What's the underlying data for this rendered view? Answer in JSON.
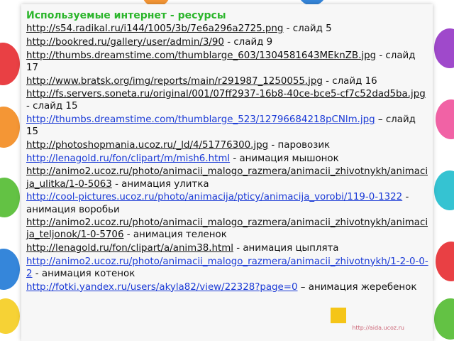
{
  "heading": "Используемые интернет - ресурсы",
  "entries": [
    {
      "url": "http://s54.radikal.ru/i144/1005/3b/7e6a296a2725.png",
      "desc": " - слайд 5",
      "color": "dark"
    },
    {
      "url": "http://bookred.ru/gallery/user/admin/3/90",
      "desc": " - слайд 9",
      "color": "dark"
    },
    {
      "url": "http://thumbs.dreamstime.com/thumblarge_603/1304581643MEknZB.jpg",
      "desc": " - слайд 17",
      "color": "dark"
    },
    {
      "url": "http://www.bratsk.org/img/reports/main/r291987_1250055.jpg",
      "desc": " - слайд 16",
      "color": "dark"
    },
    {
      "url": "http://fs.servers.soneta.ru/original/001/07ff2937-16b8-40ce-bce5-cf7c52dad5ba.jpg",
      "desc": " - слайд 15",
      "color": "dark"
    },
    {
      "url": "http://thumbs.dreamstime.com/thumblarge_523/12796684218pCNlm.jpg",
      "desc": " – слайд 15",
      "color": "blue"
    },
    {
      "url": "http://photoshopmania.ucoz.ru/_ld/4/51776300.jpg",
      "desc": " - паровозик",
      "color": "dark"
    },
    {
      "url": "http://lenagold.ru/fon/clipart/m/mish6.html",
      "desc": " - анимация мышонок",
      "color": "blue"
    },
    {
      "url": "http://animo2.ucoz.ru/photo/animacii_malogo_razmera/animacii_zhivotnykh/animacija_ulitka/1-0-5063",
      "desc": " - анимация улитка",
      "color": "dark"
    },
    {
      "url": "http://cool-pictures.ucoz.ru/photo/animacija/pticy/animacija_vorobi/119-0-1322",
      "desc": " - анимация воробьи",
      "color": "blue"
    },
    {
      "url": "http://animo2.ucoz.ru/photo/animacii_malogo_razmera/animacii_zhivotnykh/animacija_teljonok/1-0-5706",
      "desc": " - анимация теленок",
      "color": "dark"
    },
    {
      "url": "http://lenagold.ru/fon/clipart/a/anim38.html",
      "desc": " - анимация цыплята",
      "color": "dark"
    },
    {
      "url": "http://animo2.ucoz.ru/photo/animacii_malogo_razmera/animacii_zhivotnykh/1-2-0-0-2",
      "desc": " - анимация котенок",
      "color": "blue"
    },
    {
      "url": "http://fotki.yandex.ru/users/akyla82/view/22328?page=0",
      "desc": " – анимация жеребенок",
      "color": "blue"
    }
  ],
  "watermark": "http://aida.ucoz.ru"
}
